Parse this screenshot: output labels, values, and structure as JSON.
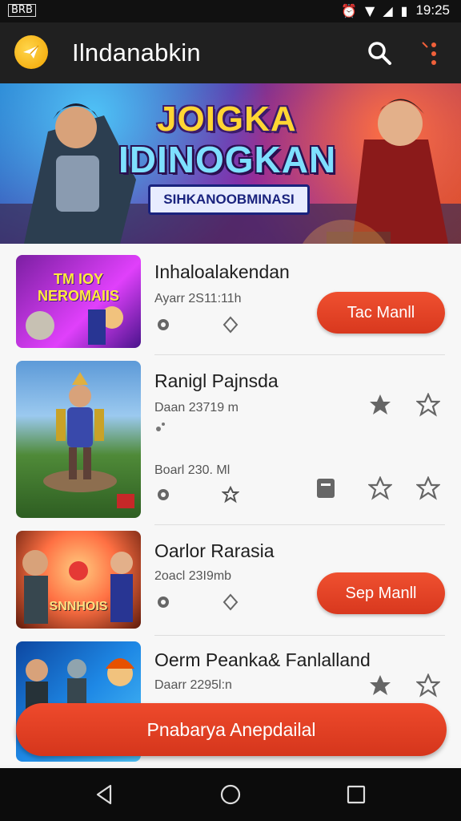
{
  "status": {
    "left_badge": "BRB",
    "time": "19:25"
  },
  "header": {
    "title": "Ilndanabkin"
  },
  "banner": {
    "title_line1": "JOIGKA",
    "title_line2": "IDINOGKAN",
    "subtitle": "SIHKANOOBMINASI"
  },
  "games": [
    {
      "thumb_text": "TM IOY NEROMAIIS",
      "title": "Inhaloalakendan",
      "meta1": "Ayarr 2S11:11h",
      "button": "Tac Manll"
    },
    {
      "thumb_text": "",
      "title": "Ranigl Pajnsda",
      "meta1": "Daan 23719 m",
      "meta2": "Boarl 230. Ml"
    },
    {
      "thumb_text": "SNNHOIS",
      "title": "Oarlor Rarasia",
      "meta1": "2oacl 23I9mb",
      "button": "Sep Manll"
    },
    {
      "thumb_text": "",
      "title": "Oerm Peanka& Fanlalland",
      "meta1": "Daarr 2295l:n"
    }
  ],
  "fab": {
    "label": "Pnabarya Anepdailal"
  },
  "colors": {
    "accent": "#e4442a",
    "appbar": "#202020"
  },
  "icons": [
    "back-icon",
    "home-icon",
    "recents-icon",
    "search-icon",
    "more-icon",
    "star-icon",
    "gear-icon",
    "diamond-icon",
    "bookmark-icon"
  ]
}
